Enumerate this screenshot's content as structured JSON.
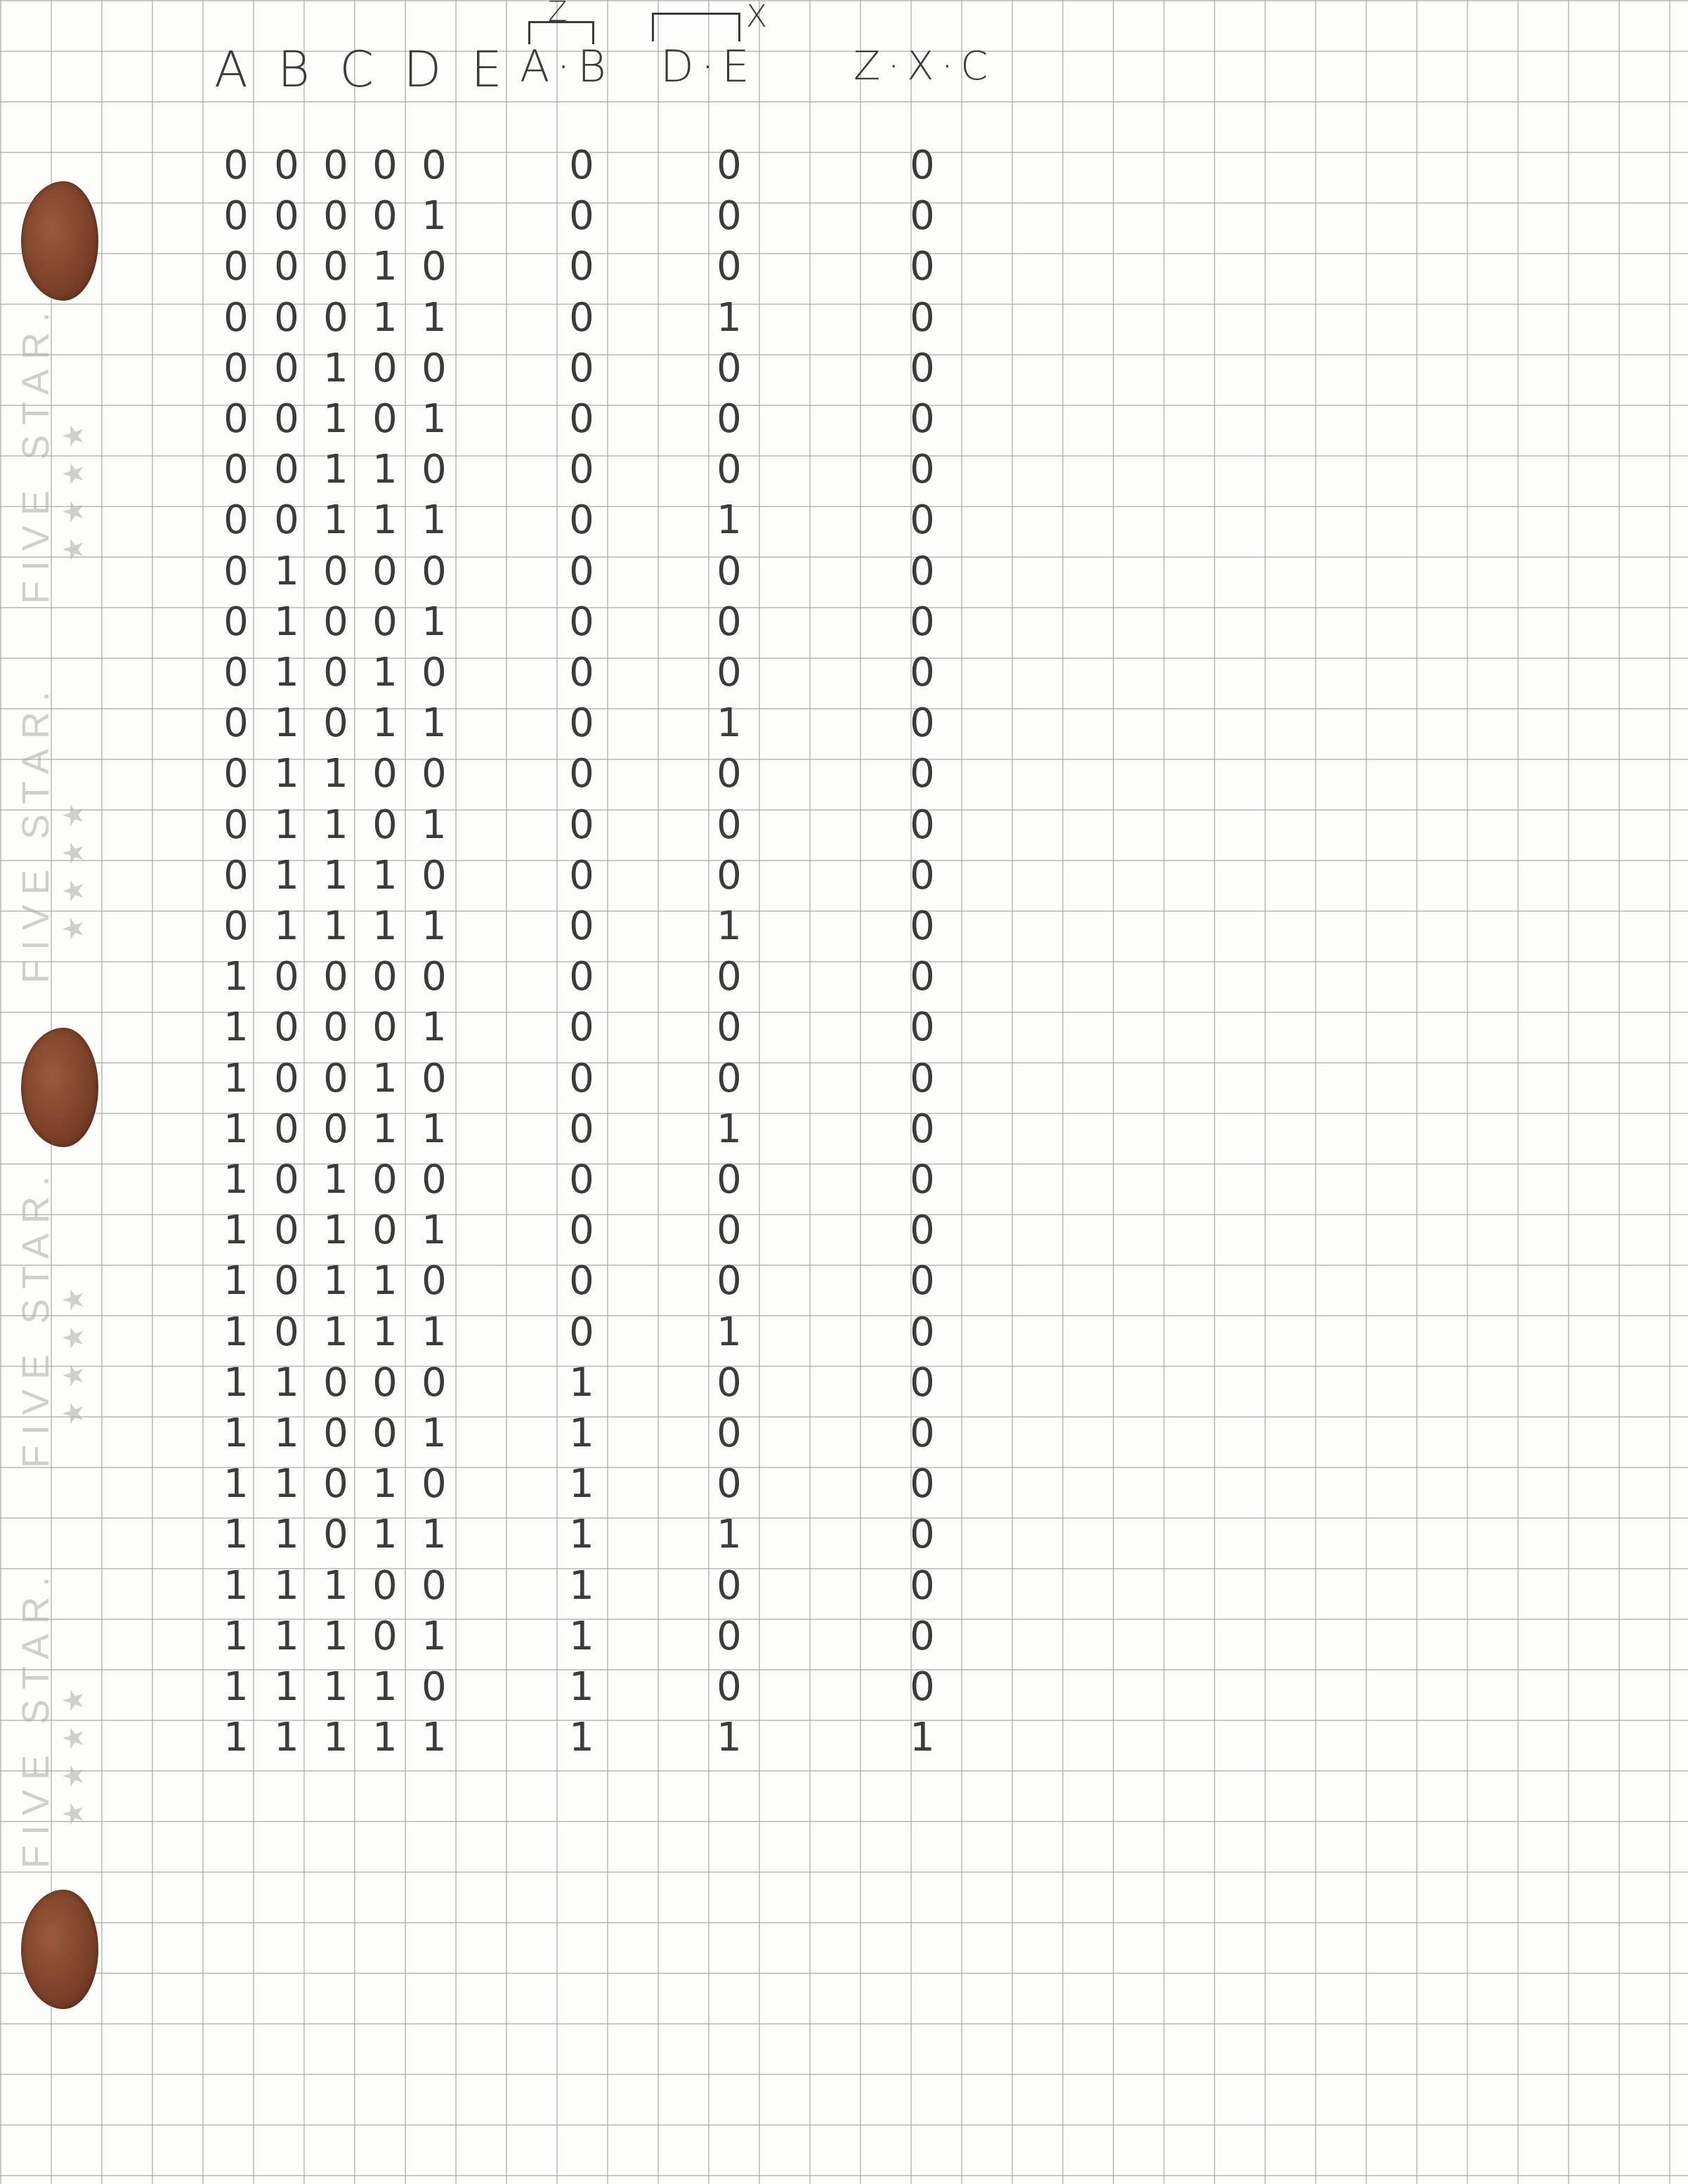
{
  "headers": {
    "inputs": "A B C D E",
    "ab": "A·B",
    "de": "D·E",
    "zxc": "Z·X·C",
    "z_label": "Z",
    "x_label": "X"
  },
  "brand": {
    "name": "FIVE STAR.",
    "stars": "★★★★"
  },
  "rows": [
    [
      "0",
      "0",
      "0",
      "0",
      "0",
      "0",
      "0",
      "0"
    ],
    [
      "0",
      "0",
      "0",
      "0",
      "1",
      "0",
      "0",
      "0"
    ],
    [
      "0",
      "0",
      "0",
      "1",
      "0",
      "0",
      "0",
      "0"
    ],
    [
      "0",
      "0",
      "0",
      "1",
      "1",
      "0",
      "1",
      "0"
    ],
    [
      "0",
      "0",
      "1",
      "0",
      "0",
      "0",
      "0",
      "0"
    ],
    [
      "0",
      "0",
      "1",
      "0",
      "1",
      "0",
      "0",
      "0"
    ],
    [
      "0",
      "0",
      "1",
      "1",
      "0",
      "0",
      "0",
      "0"
    ],
    [
      "0",
      "0",
      "1",
      "1",
      "1",
      "0",
      "1",
      "0"
    ],
    [
      "0",
      "1",
      "0",
      "0",
      "0",
      "0",
      "0",
      "0"
    ],
    [
      "0",
      "1",
      "0",
      "0",
      "1",
      "0",
      "0",
      "0"
    ],
    [
      "0",
      "1",
      "0",
      "1",
      "0",
      "0",
      "0",
      "0"
    ],
    [
      "0",
      "1",
      "0",
      "1",
      "1",
      "0",
      "1",
      "0"
    ],
    [
      "0",
      "1",
      "1",
      "0",
      "0",
      "0",
      "0",
      "0"
    ],
    [
      "0",
      "1",
      "1",
      "0",
      "1",
      "0",
      "0",
      "0"
    ],
    [
      "0",
      "1",
      "1",
      "1",
      "0",
      "0",
      "0",
      "0"
    ],
    [
      "0",
      "1",
      "1",
      "1",
      "1",
      "0",
      "1",
      "0"
    ],
    [
      "1",
      "0",
      "0",
      "0",
      "0",
      "0",
      "0",
      "0"
    ],
    [
      "1",
      "0",
      "0",
      "0",
      "1",
      "0",
      "0",
      "0"
    ],
    [
      "1",
      "0",
      "0",
      "1",
      "0",
      "0",
      "0",
      "0"
    ],
    [
      "1",
      "0",
      "0",
      "1",
      "1",
      "0",
      "1",
      "0"
    ],
    [
      "1",
      "0",
      "1",
      "0",
      "0",
      "0",
      "0",
      "0"
    ],
    [
      "1",
      "0",
      "1",
      "0",
      "1",
      "0",
      "0",
      "0"
    ],
    [
      "1",
      "0",
      "1",
      "1",
      "0",
      "0",
      "0",
      "0"
    ],
    [
      "1",
      "0",
      "1",
      "1",
      "1",
      "0",
      "1",
      "0"
    ],
    [
      "1",
      "1",
      "0",
      "0",
      "0",
      "1",
      "0",
      "0"
    ],
    [
      "1",
      "1",
      "0",
      "0",
      "1",
      "1",
      "0",
      "0"
    ],
    [
      "1",
      "1",
      "0",
      "1",
      "0",
      "1",
      "0",
      "0"
    ],
    [
      "1",
      "1",
      "0",
      "1",
      "1",
      "1",
      "1",
      "0"
    ],
    [
      "1",
      "1",
      "1",
      "0",
      "0",
      "1",
      "0",
      "0"
    ],
    [
      "1",
      "1",
      "1",
      "0",
      "1",
      "1",
      "0",
      "0"
    ],
    [
      "1",
      "1",
      "1",
      "1",
      "0",
      "1",
      "0",
      "0"
    ],
    [
      "1",
      "1",
      "1",
      "1",
      "1",
      "1",
      "1",
      "1"
    ]
  ]
}
